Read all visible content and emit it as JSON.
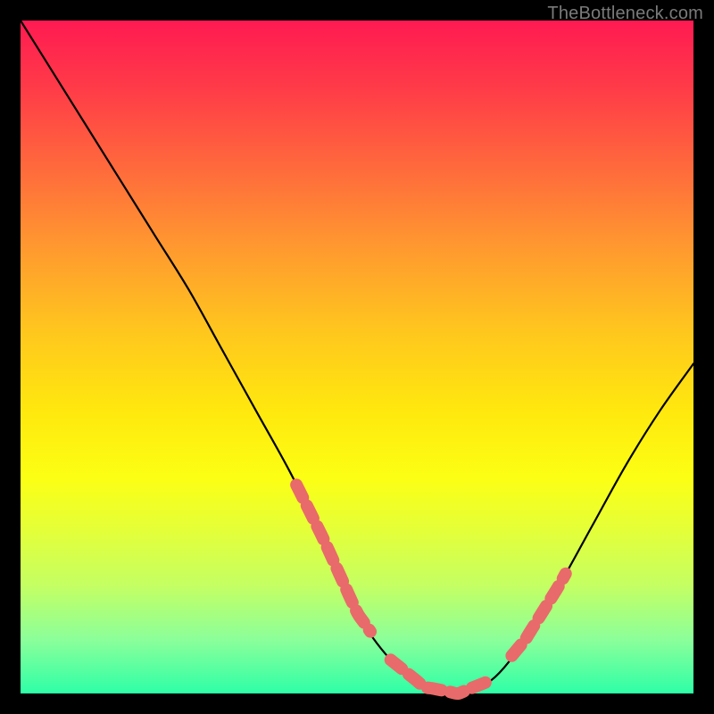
{
  "watermark": "TheBottleneck.com",
  "colors": {
    "background": "#000000",
    "gradient_top": "#ff1a52",
    "gradient_bottom": "#2effa7",
    "curve": "#000000",
    "overlay": "#e96a6a"
  },
  "chart_data": {
    "type": "line",
    "title": "",
    "xlabel": "",
    "ylabel": "",
    "xlim": [
      0,
      100
    ],
    "ylim": [
      0,
      100
    ],
    "grid": false,
    "series": [
      {
        "name": "bottleneck-curve",
        "x": [
          0,
          5,
          10,
          15,
          20,
          25,
          30,
          35,
          40,
          45,
          50,
          55,
          60,
          65,
          70,
          75,
          80,
          85,
          90,
          95,
          100
        ],
        "values": [
          100,
          92,
          84,
          76,
          68,
          60,
          51,
          42,
          33,
          23,
          12,
          5,
          1,
          0,
          2,
          8,
          16,
          25,
          34,
          42,
          49
        ]
      }
    ],
    "annotations": [
      {
        "name": "left-threshold-segment",
        "x_range": [
          41,
          52
        ]
      },
      {
        "name": "valley-flat-segment",
        "x_range": [
          55,
          70
        ]
      },
      {
        "name": "right-threshold-segment",
        "x_range": [
          73,
          81
        ]
      }
    ]
  }
}
